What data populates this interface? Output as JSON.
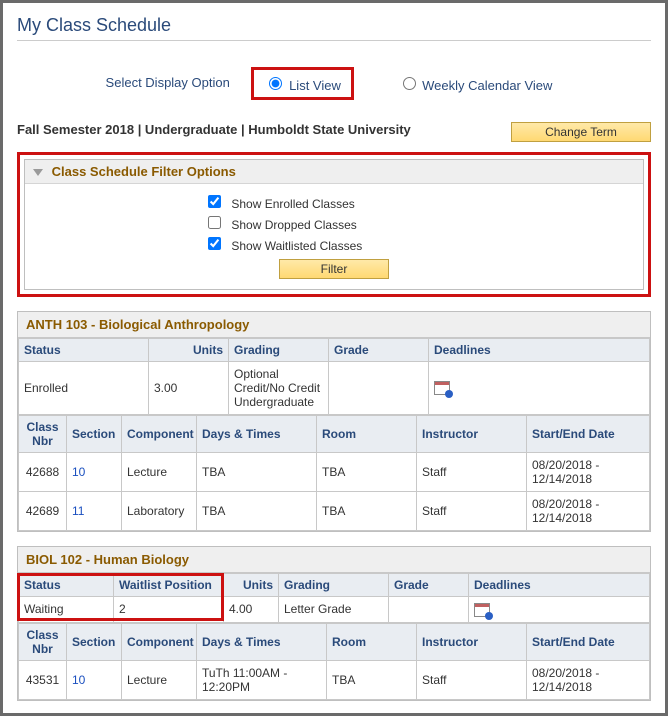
{
  "page_title": "My Class Schedule",
  "display_option": {
    "label": "Select Display Option",
    "list_view": "List View",
    "calendar_view": "Weekly Calendar View",
    "selected": "list"
  },
  "term": {
    "text": "Fall Semester 2018 | Undergraduate | Humboldt State University",
    "change_button": "Change Term"
  },
  "filter": {
    "title": "Class Schedule Filter Options",
    "show_enrolled": "Show Enrolled Classes",
    "show_dropped": "Show Dropped Classes",
    "show_waitlisted": "Show Waitlisted Classes",
    "enrolled_checked": true,
    "dropped_checked": false,
    "waitlisted_checked": true,
    "button": "Filter"
  },
  "columns": {
    "status": "Status",
    "waitlist_position": "Waitlist Position",
    "units": "Units",
    "grading": "Grading",
    "grade": "Grade",
    "deadlines": "Deadlines",
    "class_nbr": "Class Nbr",
    "section": "Section",
    "component": "Component",
    "days_times": "Days & Times",
    "room": "Room",
    "instructor": "Instructor",
    "start_end": "Start/End Date"
  },
  "courses": [
    {
      "header": "ANTH 103 - Biological Anthropology",
      "summary": {
        "status": "Enrolled",
        "units": "3.00",
        "grading": "Optional Credit/No Credit Undergraduate",
        "grade": ""
      },
      "sections": [
        {
          "class_nbr": "42688",
          "section": "10",
          "component": "Lecture",
          "days_times": "TBA",
          "room": "TBA",
          "instructor": "Staff",
          "start_end": "08/20/2018 - 12/14/2018"
        },
        {
          "class_nbr": "42689",
          "section": "11",
          "component": "Laboratory",
          "days_times": "TBA",
          "room": "TBA",
          "instructor": "Staff",
          "start_end": "08/20/2018 - 12/14/2018"
        }
      ]
    },
    {
      "header": "BIOL 102 - Human Biology",
      "summary": {
        "status": "Waiting",
        "waitlist_position": "2",
        "units": "4.00",
        "grading": "Letter Grade",
        "grade": ""
      },
      "sections": [
        {
          "class_nbr": "43531",
          "section": "10",
          "component": "Lecture",
          "days_times": "TuTh 11:00AM - 12:20PM",
          "room": "TBA",
          "instructor": "Staff",
          "start_end": "08/20/2018 - 12/14/2018"
        }
      ]
    }
  ]
}
